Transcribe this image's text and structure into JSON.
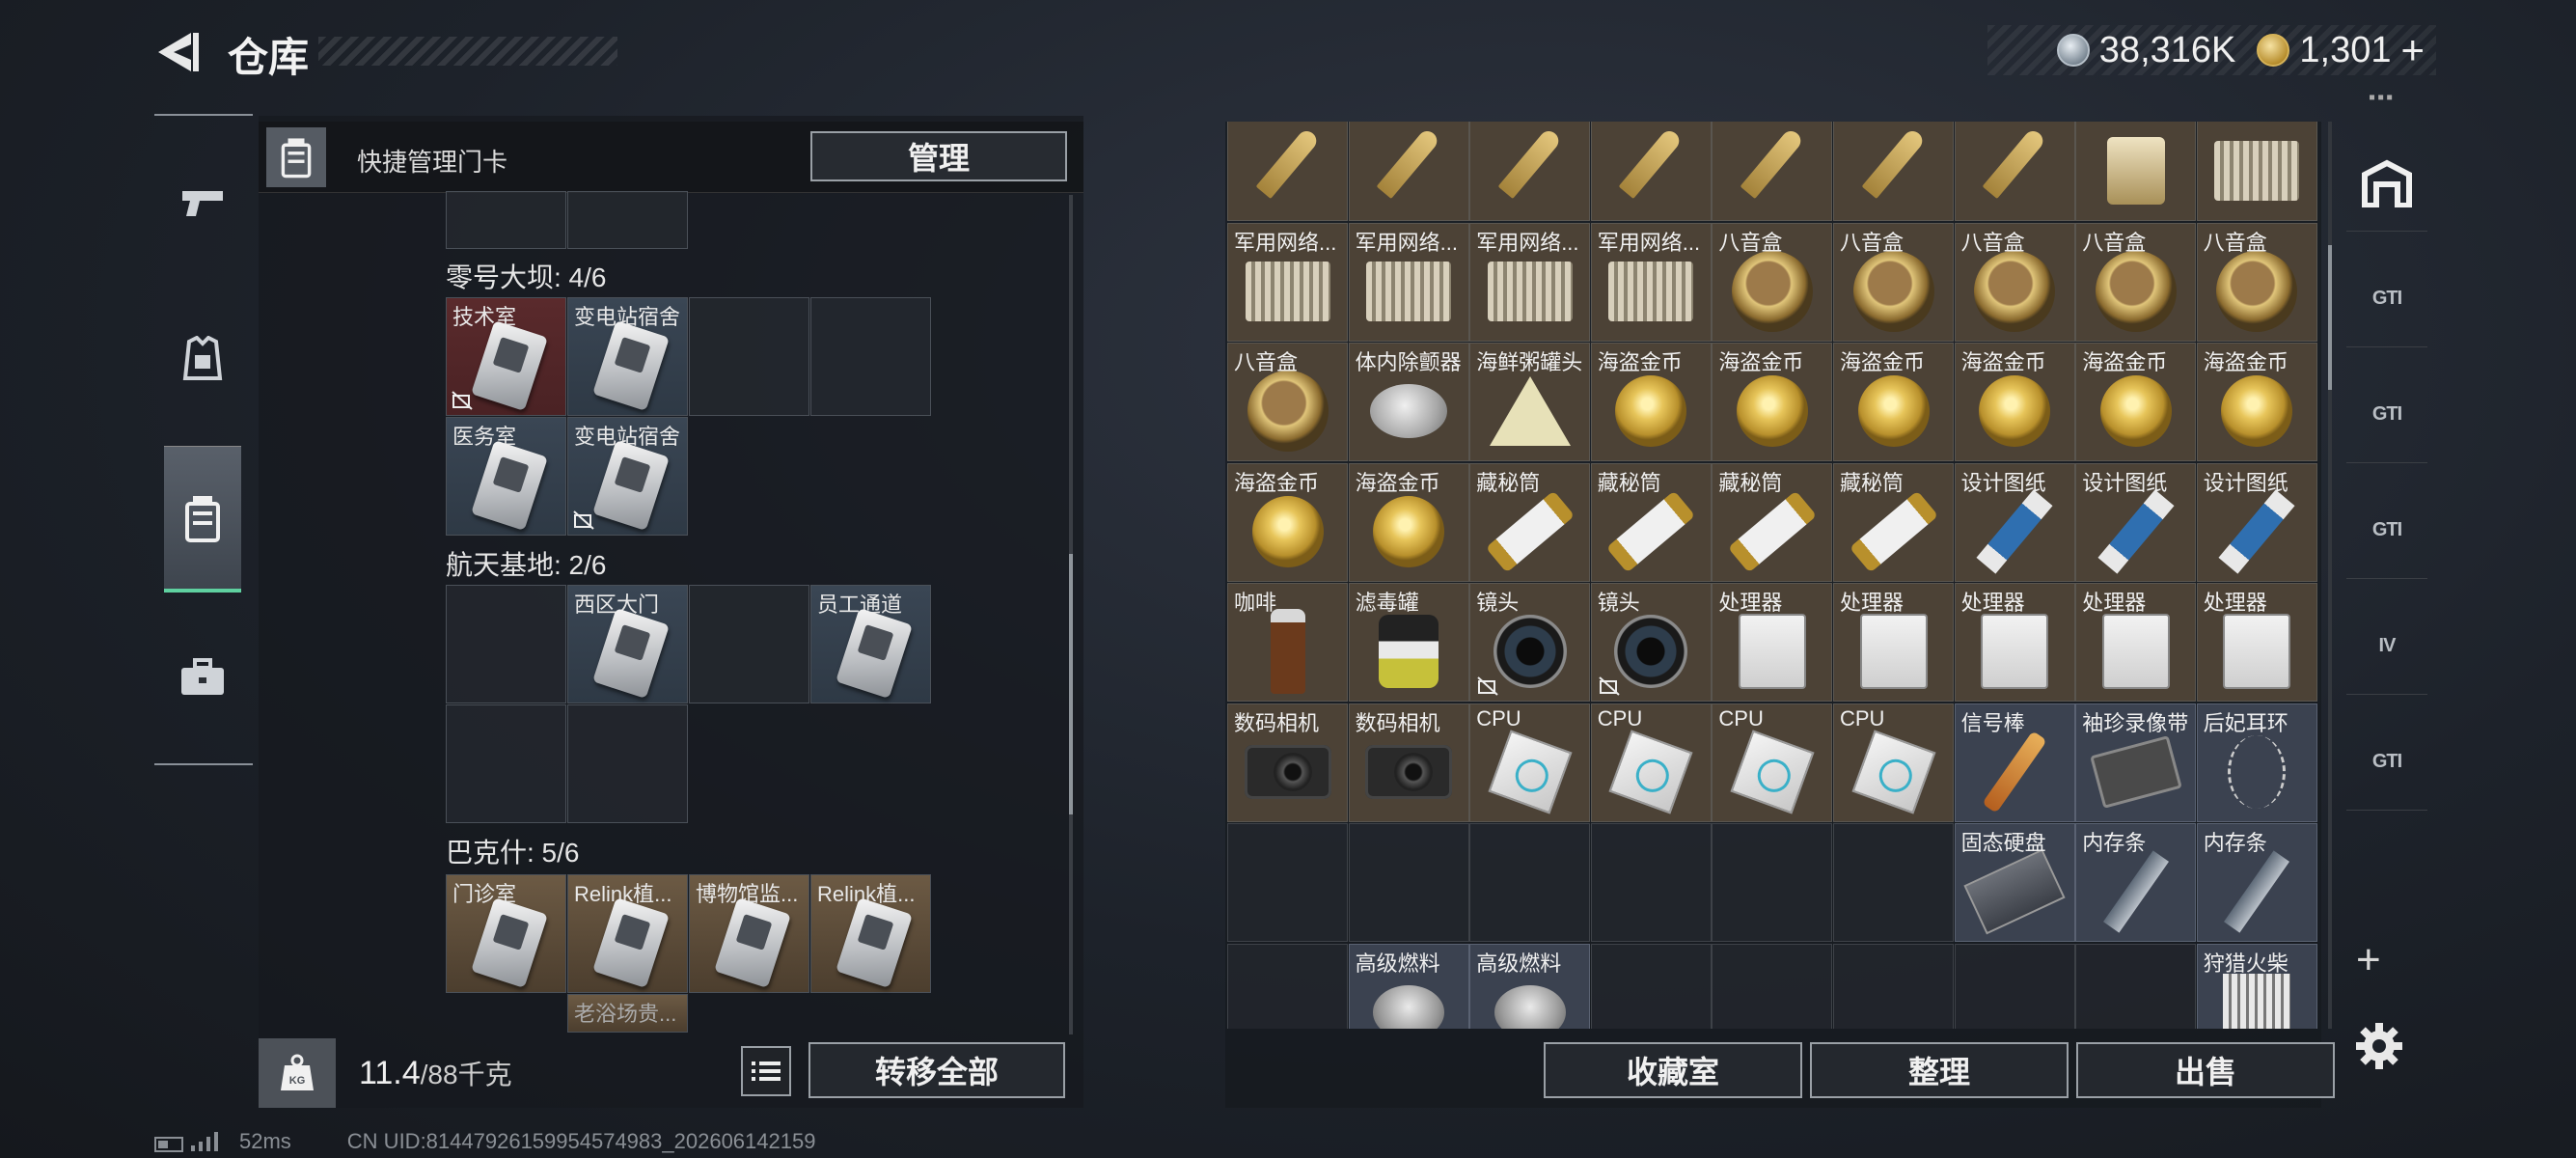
{
  "header": {
    "title": "仓库",
    "currency_silver": "38,316K",
    "currency_gold": "1,301",
    "plus_symbol": "+"
  },
  "left_nav": {
    "items": [
      {
        "icon": "pistol-icon"
      },
      {
        "icon": "armor-icon"
      },
      {
        "icon": "keycard-case-icon",
        "active": true
      },
      {
        "icon": "briefcase-icon"
      }
    ]
  },
  "keycard_panel": {
    "header_label": "快捷管理门卡",
    "manage_label": "管理",
    "groups": [
      {
        "label": "零号大坝: 4/6",
        "cards": [
          {
            "label": "技术室"
          },
          {
            "label": "变电站宿舍"
          },
          {
            "label": "医务室"
          },
          {
            "label": "变电站宿舍"
          }
        ]
      },
      {
        "label": "航天基地: 2/6",
        "cards": [
          {
            "label": "西区大门"
          },
          {
            "label": "员工通道"
          }
        ]
      },
      {
        "label": "巴克什: 5/6",
        "cards": [
          {
            "label": "门诊室"
          },
          {
            "label": "Relink植..."
          },
          {
            "label": "博物馆监..."
          },
          {
            "label": "Relink植..."
          },
          {
            "label": "老浴场贵..."
          }
        ]
      }
    ],
    "weight_current": "11.4",
    "weight_capacity": "/88千克",
    "transfer_all_label": "转移全部"
  },
  "status_bar": {
    "ping": "52ms",
    "uid": "CN UID:814479261599545749​83_202606142159"
  },
  "stash": {
    "rows": [
      [
        {
          "label": "",
          "art": "bullet"
        },
        {
          "label": "",
          "art": "bullet"
        },
        {
          "label": "",
          "art": "bullet"
        },
        {
          "label": "",
          "art": "bullet"
        },
        {
          "label": "",
          "art": "bullet"
        },
        {
          "label": "",
          "art": "bullet"
        },
        {
          "label": "",
          "art": "bullet"
        },
        {
          "label": "",
          "art": "lighter"
        },
        {
          "label": "",
          "art": "router"
        }
      ],
      [
        {
          "label": "军用网络...",
          "art": "router"
        },
        {
          "label": "军用网络...",
          "art": "router"
        },
        {
          "label": "军用网络...",
          "art": "router"
        },
        {
          "label": "军用网络...",
          "art": "router"
        },
        {
          "label": "八音盒",
          "art": "disc"
        },
        {
          "label": "八音盒",
          "art": "disc"
        },
        {
          "label": "八音盒",
          "art": "disc"
        },
        {
          "label": "八音盒",
          "art": "disc"
        },
        {
          "label": "八音盒",
          "art": "disc"
        }
      ],
      [
        {
          "label": "八音盒",
          "art": "disc"
        },
        {
          "label": "体内除颤器",
          "art": "tin"
        },
        {
          "label": "海鲜粥罐头",
          "art": "triangle"
        },
        {
          "label": "海盗金币",
          "art": "coin-gold"
        },
        {
          "label": "海盗金币",
          "art": "coin-gold"
        },
        {
          "label": "海盗金币",
          "art": "coin-gold"
        },
        {
          "label": "海盗金币",
          "art": "coin-gold"
        },
        {
          "label": "海盗金币",
          "art": "coin-gold"
        },
        {
          "label": "海盗金币",
          "art": "coin-gold"
        }
      ],
      [
        {
          "label": "海盗金币",
          "art": "coin-gold"
        },
        {
          "label": "海盗金币",
          "art": "coin-gold"
        },
        {
          "label": "藏秘筒",
          "art": "cylinder"
        },
        {
          "label": "藏秘筒",
          "art": "cylinder"
        },
        {
          "label": "藏秘筒",
          "art": "cylinder"
        },
        {
          "label": "藏秘筒",
          "art": "cylinder"
        },
        {
          "label": "设计图纸",
          "art": "blueprint"
        },
        {
          "label": "设计图纸",
          "art": "blueprint"
        },
        {
          "label": "设计图纸",
          "art": "blueprint"
        }
      ],
      [
        {
          "label": "咖啡",
          "art": "coffee"
        },
        {
          "label": "滤毒罐",
          "art": "filter"
        },
        {
          "label": "镜头",
          "art": "lens",
          "marked": true
        },
        {
          "label": "镜头",
          "art": "lens",
          "marked": true
        },
        {
          "label": "处理器",
          "art": "cpu-proc"
        },
        {
          "label": "处理器",
          "art": "cpu-proc"
        },
        {
          "label": "处理器",
          "art": "cpu-proc"
        },
        {
          "label": "处理器",
          "art": "cpu-proc"
        },
        {
          "label": "处理器",
          "art": "cpu-proc"
        }
      ],
      [
        {
          "label": "数码相机",
          "art": "camera"
        },
        {
          "label": "数码相机",
          "art": "camera"
        },
        {
          "label": "CPU",
          "art": "chip"
        },
        {
          "label": "CPU",
          "art": "chip"
        },
        {
          "label": "CPU",
          "art": "chip"
        },
        {
          "label": "CPU",
          "art": "chip"
        },
        {
          "label": "信号棒",
          "art": "stick",
          "tint": "blue"
        },
        {
          "label": "袖珍录像带",
          "art": "tape",
          "tint": "blue"
        },
        {
          "label": "后妃耳环",
          "art": "earring",
          "tint": "blue"
        }
      ],
      [
        {
          "label": "",
          "art": ""
        },
        {
          "label": "",
          "art": ""
        },
        {
          "label": "",
          "art": ""
        },
        {
          "label": "",
          "art": ""
        },
        {
          "label": "",
          "art": ""
        },
        {
          "label": "",
          "art": ""
        },
        {
          "label": "固态硬盘",
          "art": "ssd",
          "tint": "blue"
        },
        {
          "label": "内存条",
          "art": "ram",
          "tint": "blue"
        },
        {
          "label": "内存条",
          "art": "ram",
          "tint": "blue"
        }
      ],
      [
        {
          "label": "",
          "art": ""
        },
        {
          "label": "高级燃料",
          "art": "fuel",
          "tint": "blue"
        },
        {
          "label": "高级燃料",
          "art": "fuel",
          "tint": "blue"
        },
        {
          "label": "",
          "art": ""
        },
        {
          "label": "",
          "art": ""
        },
        {
          "label": "",
          "art": ""
        },
        {
          "label": "",
          "art": ""
        },
        {
          "label": "",
          "art": ""
        },
        {
          "label": "狩猎火柴",
          "art": "matches",
          "tint": "blue"
        }
      ]
    ]
  },
  "bottom_actions": {
    "collection_label": "收藏室",
    "sort_label": "整理",
    "sell_label": "出售"
  },
  "side_tabs": [
    {
      "icon": "warehouse-icon",
      "text": ""
    },
    {
      "icon": "gti-tab-icon",
      "text": "GTI"
    },
    {
      "icon": "gti-tab-icon",
      "text": "GTI"
    },
    {
      "icon": "gti-tab-icon",
      "text": "GTI"
    },
    {
      "icon": "gti-tab-icon",
      "text": "IV"
    },
    {
      "icon": "gti-tab-icon",
      "text": "GTI"
    }
  ],
  "colors": {
    "accent_green": "#5fd1a0",
    "cell_brown": "#4c4236",
    "cell_blue": "#3b4250"
  }
}
